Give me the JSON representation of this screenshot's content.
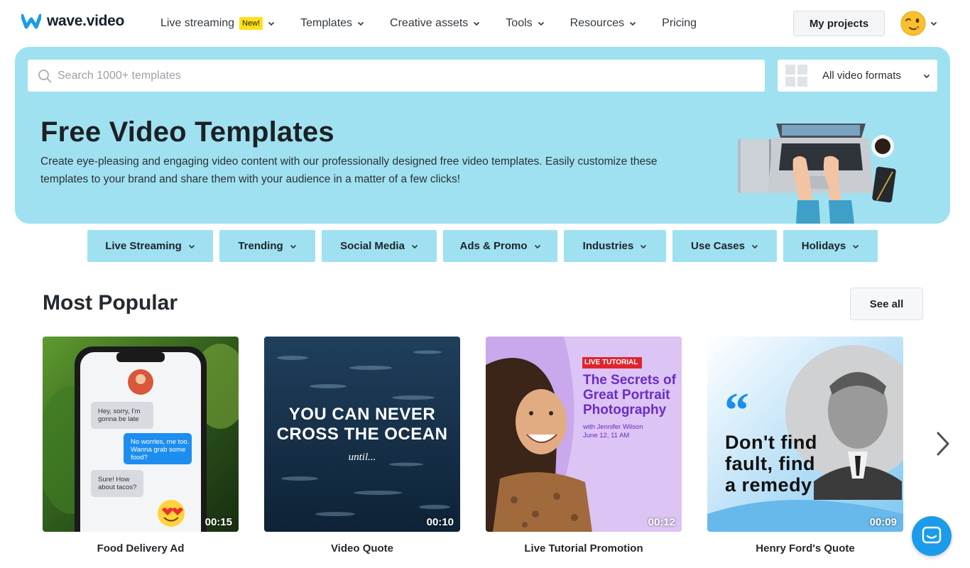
{
  "brand": {
    "name": "wave.video",
    "color": "#1c9bea"
  },
  "nav": {
    "items": [
      {
        "label": "Live streaming",
        "badge": "New!",
        "dropdown": true
      },
      {
        "label": "Templates",
        "dropdown": true
      },
      {
        "label": "Creative assets",
        "dropdown": true
      },
      {
        "label": "Tools",
        "dropdown": true
      },
      {
        "label": "Resources",
        "dropdown": true
      },
      {
        "label": "Pricing",
        "dropdown": false
      }
    ],
    "my_projects": "My projects",
    "avatar_icon": "winking-face-emoji"
  },
  "search": {
    "placeholder": "Search 1000+ templates",
    "value": ""
  },
  "format_select": {
    "selected": "All video formats"
  },
  "hero": {
    "title": "Free Video Templates",
    "description": "Create eye-pleasing and engaging video content with our professionally designed free video templates. Easily customize these templates to your brand and share them with your audience in a matter of a few clicks!",
    "background": "#9fe1f0"
  },
  "categories": [
    "Live Streaming",
    "Trending",
    "Social Media",
    "Ads & Promo",
    "Industries",
    "Use Cases",
    "Holidays"
  ],
  "section": {
    "title": "Most Popular",
    "see_all": "See all"
  },
  "cards": [
    {
      "title": "Food Delivery Ad",
      "duration": "00:15",
      "messages": [
        "Hey, sorry, I'm gonna be late",
        "No worries, me too. Wanna grab some food?",
        "Sure! How about tacos?"
      ]
    },
    {
      "title": "Video Quote",
      "duration": "00:10",
      "overlay_lines": [
        "YOU CAN NEVER",
        "CROSS THE OCEAN"
      ],
      "overlay_sub": "until..."
    },
    {
      "title": "Live Tutorial Promotion",
      "duration": "00:12",
      "tag": "LIVE TUTORIAL",
      "overlay_lines": [
        "The Secrets of",
        "Great Portrait",
        "Photography"
      ],
      "overlay_sub": [
        "with Jennifer Wilson",
        "June 12, 11 AM"
      ]
    },
    {
      "title": "Henry Ford's Quote",
      "duration": "00:09",
      "quote_mark": "“",
      "overlay_lines": [
        "Don't find",
        "fault, find",
        "a remedy"
      ]
    }
  ],
  "icons": {
    "search": "search-icon",
    "formats": "grid-icon",
    "next": "chevron-right-icon",
    "chat": "chat-icon"
  }
}
